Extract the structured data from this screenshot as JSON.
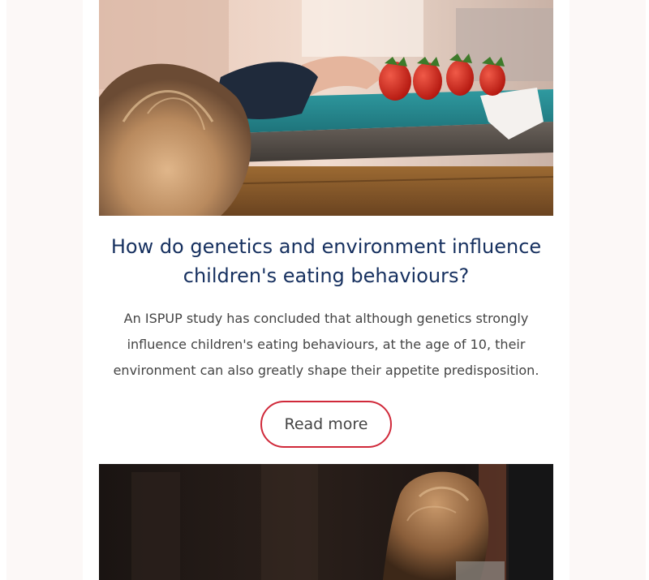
{
  "articles": [
    {
      "image": "child-reaching-for-strawberries-photo",
      "title": "How do genetics and environment influence children's eating behaviours?",
      "summary": "An ISPUP study has concluded that although genetics strongly influence children's eating behaviours, at the age of 10, their environment can also greatly shape their appetite predisposition.",
      "cta_label": "Read more"
    },
    {
      "image": "woman-with-long-hair-in-dim-room-photo"
    }
  ],
  "colors": {
    "background": "#fcf8f7",
    "card": "#ffffff",
    "title": "#16305f",
    "body_text": "#444444",
    "button_border": "#d0293a"
  }
}
